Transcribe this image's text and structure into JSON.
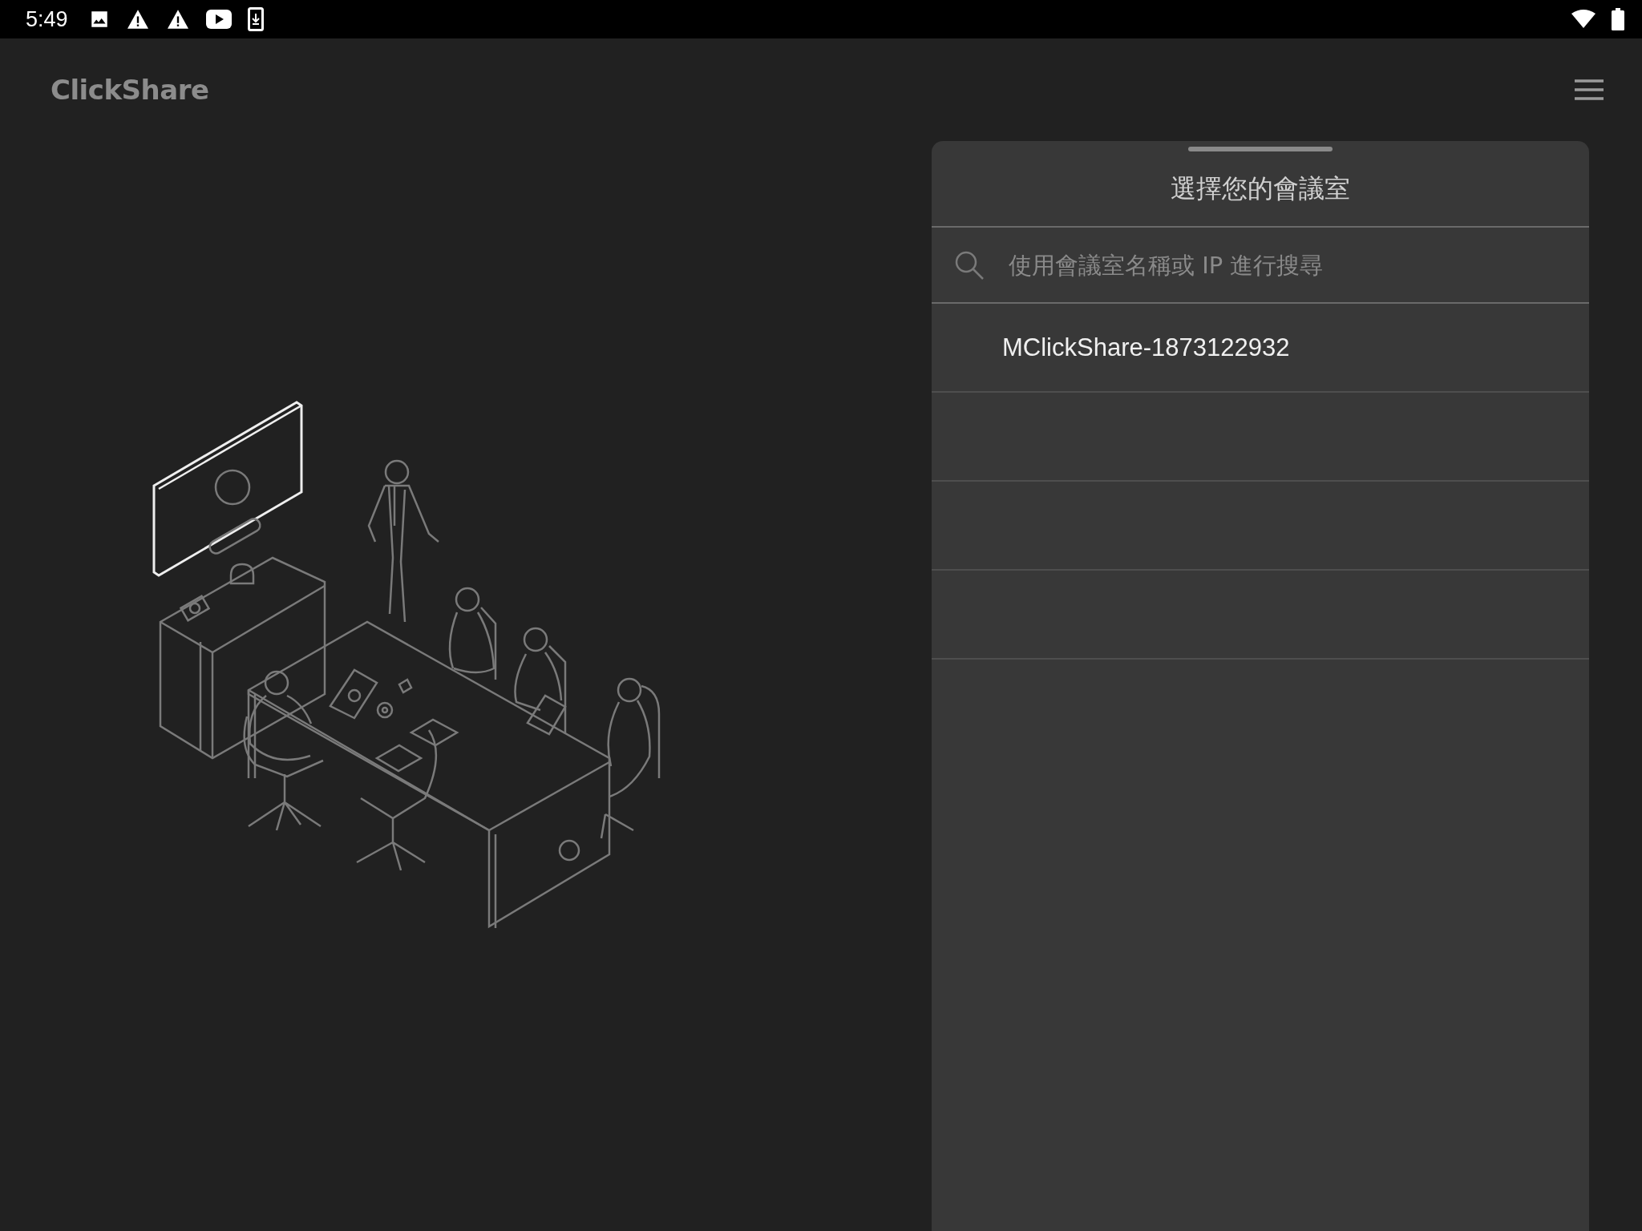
{
  "status_bar": {
    "time": "5:49"
  },
  "app_bar": {
    "logo": "ClickShare"
  },
  "room_panel": {
    "title": "選擇您的會議室",
    "search": {
      "placeholder": "使用會議室名稱或 IP 進行搜尋"
    },
    "rooms": [
      {
        "name": "MClickShare-1873122932"
      }
    ]
  }
}
